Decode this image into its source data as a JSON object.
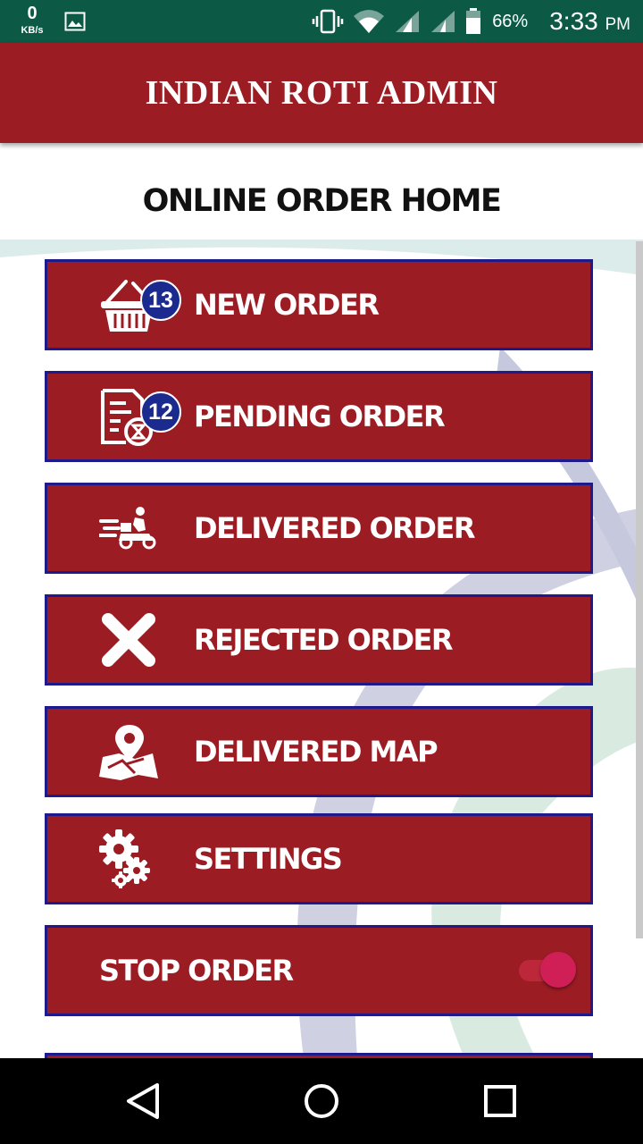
{
  "status_bar": {
    "net_speed_value": "0",
    "net_speed_unit": "KB/s",
    "battery_percent": "66%",
    "time": "3:33",
    "time_suffix": "PM",
    "icons": [
      "image-icon",
      "vibrate-icon",
      "wifi-icon",
      "signal-icon",
      "signal-icon",
      "battery-icon"
    ]
  },
  "app_bar": {
    "title": "INDIAN ROTI ADMIN"
  },
  "page": {
    "title": "ONLINE ORDER HOME"
  },
  "menu": {
    "items": [
      {
        "label": "NEW ORDER",
        "icon": "basket-icon",
        "badge": "13"
      },
      {
        "label": "PENDING ORDER",
        "icon": "pending-document-icon",
        "badge": "12"
      },
      {
        "label": "DELIVERED ORDER",
        "icon": "delivery-scooter-icon"
      },
      {
        "label": "REJECTED ORDER",
        "icon": "close-icon"
      },
      {
        "label": "DELIVERED MAP",
        "icon": "map-pin-icon"
      },
      {
        "label": "SETTINGS",
        "icon": "gear-icon"
      }
    ],
    "stop_order": {
      "label": "STOP ORDER",
      "enabled": true
    }
  },
  "colors": {
    "status_bar": "#0c5a45",
    "primary": "#9b1c23",
    "item_border": "#1f1a8c",
    "badge": "#1a2a8e",
    "toggle": "#d01f56"
  },
  "nav_bar": {
    "buttons": [
      "back-icon",
      "home-icon",
      "recents-icon"
    ]
  }
}
